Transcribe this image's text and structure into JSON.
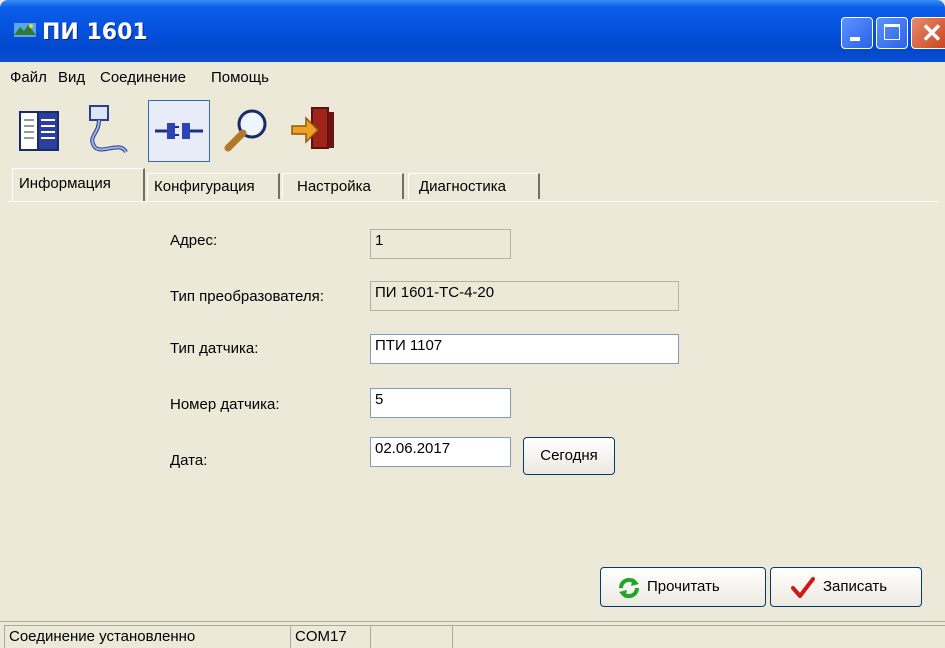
{
  "window": {
    "title": "ПИ 1601"
  },
  "menu": {
    "items": [
      "Файл",
      "Вид",
      "Соединение",
      "Помощь"
    ]
  },
  "toolbar": {
    "buttons": [
      {
        "icon": "book-icon"
      },
      {
        "icon": "cable-icon"
      },
      {
        "icon": "connect-icon",
        "active": true
      },
      {
        "icon": "magnifier-icon"
      },
      {
        "icon": "exit-icon"
      }
    ]
  },
  "tabs": {
    "items": [
      "Информация",
      "Конфигурация",
      "Настройка",
      "Диагностика"
    ],
    "active": "Информация"
  },
  "form": {
    "address_label": "Адрес:",
    "address_value": "1",
    "converter_type_label": "Тип преобразователя:",
    "converter_type_value": "ПИ 1601-ТС-4-20",
    "sensor_type_label": "Тип датчика:",
    "sensor_type_value": "ПТИ 1107",
    "sensor_number_label": "Номер датчика:",
    "sensor_number_value": "5",
    "date_label": "Дата:",
    "date_value": "02.06.2017",
    "today_button": "Сегодня"
  },
  "actions": {
    "read_button": "Прочитать",
    "write_button": "Записать"
  },
  "status": {
    "connection": "Соединение установленно",
    "port": "COM17",
    "cell3": "",
    "cell4": ""
  },
  "colors": {
    "titlebar": "#0553e0",
    "window_bg": "#ece9d8",
    "read_icon": "#22a32a",
    "write_icon": "#d01818"
  }
}
